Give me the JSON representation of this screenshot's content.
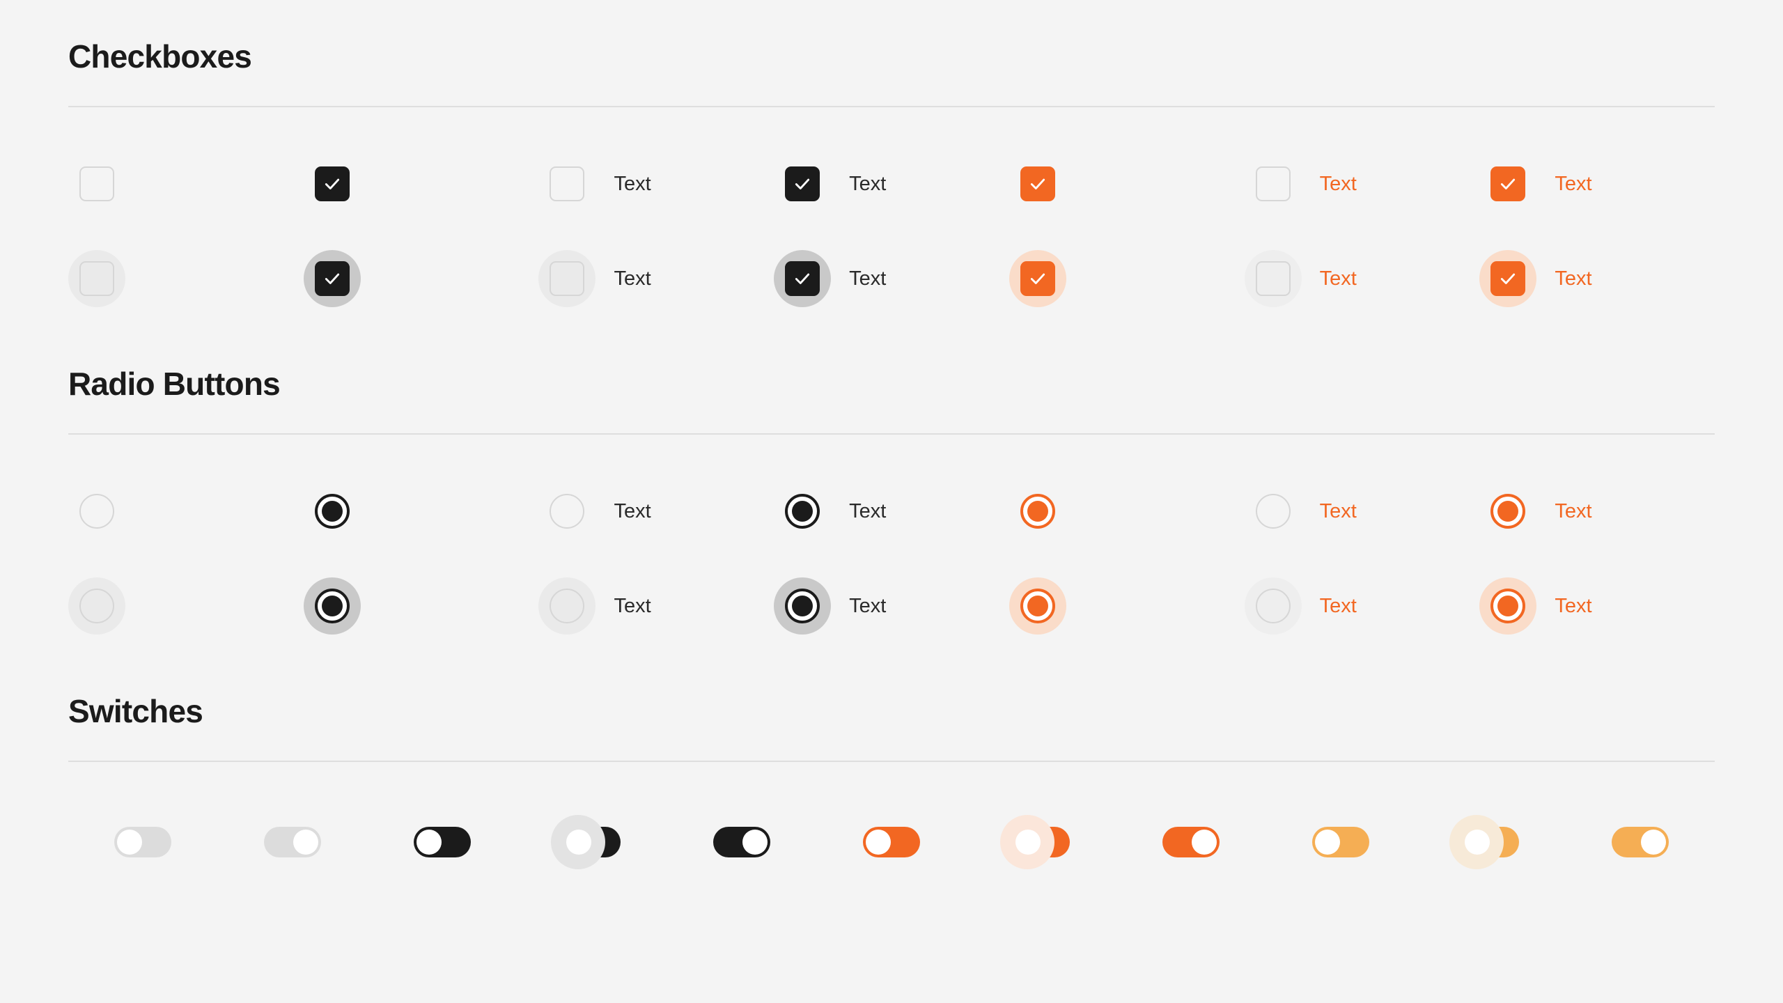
{
  "theme": {
    "background": "#f4f4f4",
    "accent_orange": "#f26722",
    "accent_amber": "#f5ae54",
    "dark": "#1b1b1b",
    "border_gray": "#d6d6d6",
    "divider": "#dedede",
    "label_dark": "#2a2a2a",
    "halo_gray_soft": "#eaeaea",
    "halo_gray": "#c9c9c9",
    "halo_peach": "#fadcc9"
  },
  "sections": {
    "checkboxes": {
      "title": "Checkboxes",
      "rows": [
        {
          "state": "default",
          "cells": [
            {
              "checked": false,
              "color": "gray",
              "label": "",
              "halo": "none"
            },
            {
              "checked": true,
              "color": "dark",
              "label": "",
              "halo": "none"
            },
            {
              "checked": false,
              "color": "gray",
              "label": "Text",
              "halo": "none"
            },
            {
              "checked": true,
              "color": "dark",
              "label": "Text",
              "halo": "none"
            },
            {
              "checked": true,
              "color": "orange",
              "label": "",
              "halo": "none"
            },
            {
              "checked": false,
              "color": "gray",
              "label": "Text",
              "halo": "none"
            },
            {
              "checked": true,
              "color": "orange",
              "label": "Text",
              "halo": "none"
            }
          ]
        },
        {
          "state": "hover",
          "cells": [
            {
              "checked": false,
              "color": "gray",
              "label": "",
              "halo": "gray-soft"
            },
            {
              "checked": true,
              "color": "dark",
              "label": "",
              "halo": "gray"
            },
            {
              "checked": false,
              "color": "gray",
              "label": "Text",
              "halo": "gray-soft"
            },
            {
              "checked": true,
              "color": "dark",
              "label": "Text",
              "halo": "gray"
            },
            {
              "checked": true,
              "color": "orange",
              "label": "",
              "halo": "peach"
            },
            {
              "checked": false,
              "color": "gray",
              "label": "Text",
              "halo": "peach-soft"
            },
            {
              "checked": true,
              "color": "orange",
              "label": "Text",
              "halo": "peach"
            }
          ]
        }
      ]
    },
    "radio_buttons": {
      "title": "Radio Buttons",
      "rows": [
        {
          "state": "default",
          "cells": [
            {
              "selected": false,
              "color": "gray",
              "label": "",
              "halo": "none"
            },
            {
              "selected": true,
              "color": "dark",
              "label": "",
              "halo": "none"
            },
            {
              "selected": false,
              "color": "gray",
              "label": "Text",
              "halo": "none"
            },
            {
              "selected": true,
              "color": "dark",
              "label": "Text",
              "halo": "none"
            },
            {
              "selected": true,
              "color": "orange",
              "label": "",
              "halo": "none"
            },
            {
              "selected": false,
              "color": "gray",
              "label": "Text",
              "halo": "none"
            },
            {
              "selected": true,
              "color": "orange",
              "label": "Text",
              "halo": "none"
            }
          ]
        },
        {
          "state": "hover",
          "cells": [
            {
              "selected": false,
              "color": "gray",
              "label": "",
              "halo": "gray-soft"
            },
            {
              "selected": true,
              "color": "dark",
              "label": "",
              "halo": "gray"
            },
            {
              "selected": false,
              "color": "gray",
              "label": "Text",
              "halo": "gray-soft"
            },
            {
              "selected": true,
              "color": "dark",
              "label": "Text",
              "halo": "gray"
            },
            {
              "selected": true,
              "color": "orange",
              "label": "",
              "halo": "peach"
            },
            {
              "selected": false,
              "color": "gray",
              "label": "Text",
              "halo": "peach-soft"
            },
            {
              "selected": true,
              "color": "orange",
              "label": "Text",
              "halo": "peach"
            }
          ]
        }
      ]
    },
    "switches": {
      "title": "Switches",
      "items": [
        {
          "track": "gray",
          "knob": "left",
          "halo": "none"
        },
        {
          "track": "gray",
          "knob": "right",
          "halo": "none"
        },
        {
          "track": "dark",
          "knob": "left",
          "halo": "none"
        },
        {
          "track": "dark",
          "knob": "left",
          "halo": "gray"
        },
        {
          "track": "dark",
          "knob": "right",
          "halo": "none"
        },
        {
          "track": "orange",
          "knob": "left",
          "halo": "none"
        },
        {
          "track": "orange",
          "knob": "left",
          "halo": "peach"
        },
        {
          "track": "orange",
          "knob": "right",
          "halo": "none"
        },
        {
          "track": "amber",
          "knob": "left",
          "halo": "none"
        },
        {
          "track": "amber",
          "knob": "left",
          "halo": "cream"
        },
        {
          "track": "amber",
          "knob": "right",
          "halo": "none"
        }
      ]
    }
  },
  "icons": {
    "check": "check-icon"
  }
}
